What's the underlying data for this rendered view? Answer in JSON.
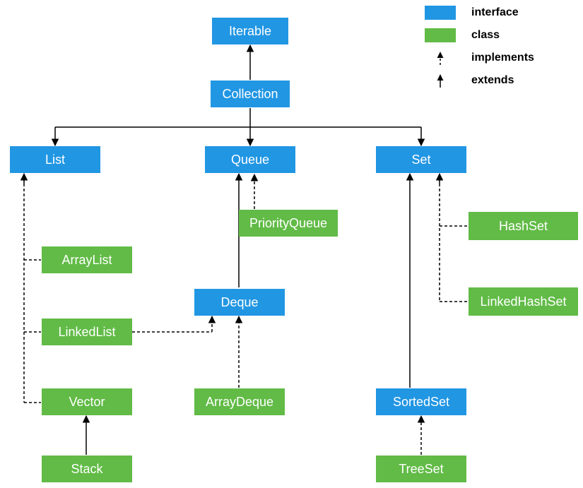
{
  "legend": {
    "interface": "interface",
    "class": "class",
    "implements": "implements",
    "extends": "extends"
  },
  "colors": {
    "interface": "#2196e3",
    "class": "#61bb46",
    "line": "#000000"
  },
  "nodes": {
    "iterable": {
      "label": "Iterable",
      "kind": "interface"
    },
    "collection": {
      "label": "Collection",
      "kind": "interface"
    },
    "list": {
      "label": "List",
      "kind": "interface"
    },
    "queue": {
      "label": "Queue",
      "kind": "interface"
    },
    "set": {
      "label": "Set",
      "kind": "interface"
    },
    "deque": {
      "label": "Deque",
      "kind": "interface"
    },
    "sortedset": {
      "label": "SortedSet",
      "kind": "interface"
    },
    "arraylist": {
      "label": "ArrayList",
      "kind": "class"
    },
    "linkedlist": {
      "label": "LinkedList",
      "kind": "class"
    },
    "vector": {
      "label": "Vector",
      "kind": "class"
    },
    "stack": {
      "label": "Stack",
      "kind": "class"
    },
    "priorityqueue": {
      "label": "PriorityQueue",
      "kind": "class"
    },
    "arraydeque": {
      "label": "ArrayDeque",
      "kind": "class"
    },
    "hashset": {
      "label": "HashSet",
      "kind": "class"
    },
    "linkedhashset": {
      "label": "LinkedHashSet",
      "kind": "class"
    },
    "treeset": {
      "label": "TreeSet",
      "kind": "class"
    }
  },
  "edges": [
    {
      "from": "collection",
      "to": "iterable",
      "rel": "extends"
    },
    {
      "from": "list",
      "to": "collection",
      "rel": "extends"
    },
    {
      "from": "queue",
      "to": "collection",
      "rel": "extends"
    },
    {
      "from": "set",
      "to": "collection",
      "rel": "extends"
    },
    {
      "from": "arraylist",
      "to": "list",
      "rel": "implements"
    },
    {
      "from": "linkedlist",
      "to": "list",
      "rel": "implements"
    },
    {
      "from": "linkedlist",
      "to": "deque",
      "rel": "implements"
    },
    {
      "from": "vector",
      "to": "list",
      "rel": "implements"
    },
    {
      "from": "stack",
      "to": "vector",
      "rel": "extends"
    },
    {
      "from": "deque",
      "to": "queue",
      "rel": "extends"
    },
    {
      "from": "priorityqueue",
      "to": "queue",
      "rel": "implements"
    },
    {
      "from": "arraydeque",
      "to": "deque",
      "rel": "implements"
    },
    {
      "from": "sortedset",
      "to": "set",
      "rel": "extends"
    },
    {
      "from": "hashset",
      "to": "set",
      "rel": "implements"
    },
    {
      "from": "linkedhashset",
      "to": "set",
      "rel": "implements"
    },
    {
      "from": "treeset",
      "to": "sortedset",
      "rel": "implements"
    }
  ]
}
